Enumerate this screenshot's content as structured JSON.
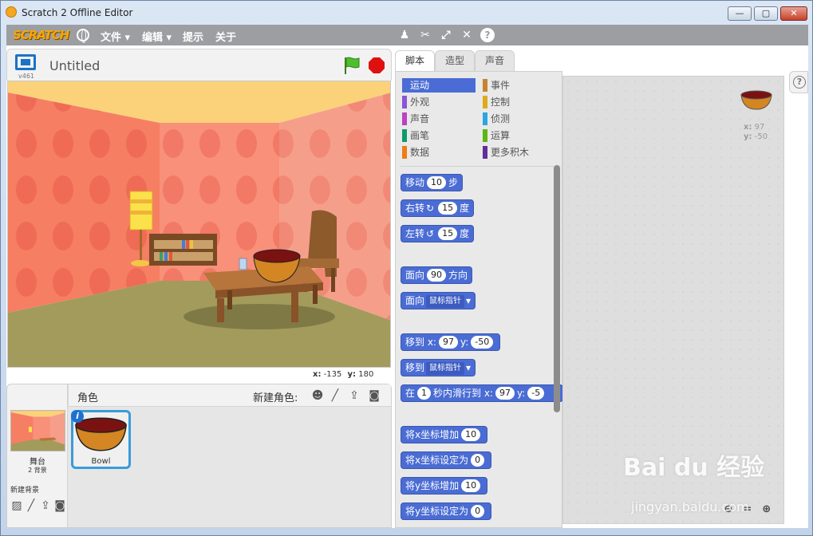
{
  "window": {
    "title": "Scratch 2 Offline Editor",
    "min": "—",
    "max": "▢",
    "close": "✕"
  },
  "menubar": {
    "logo": "SCRATCH",
    "items": [
      "文件 ▾",
      "编辑 ▾",
      "提示",
      "关于"
    ],
    "tools": [
      "stamp-icon",
      "cut-icon",
      "grow-icon",
      "shrink-icon",
      "help-icon"
    ]
  },
  "stage": {
    "version": "v461",
    "project_title": "Untitled",
    "coords": {
      "x_label": "x:",
      "x": "-135",
      "y_label": "y:",
      "y": "180"
    }
  },
  "sprites": {
    "label": "角色",
    "new_sprite_label": "新建角色:",
    "stage_name": "舞台",
    "stage_bg_count": "2 背景",
    "new_backdrop_label": "新建背景",
    "sprite_name": "Bowl"
  },
  "tabs": [
    "脚本",
    "造型",
    "声音"
  ],
  "categories": {
    "left": [
      {
        "label": "运动",
        "color": "#4a6cd4"
      },
      {
        "label": "外观",
        "color": "#8a55d7"
      },
      {
        "label": "声音",
        "color": "#bb42c3"
      },
      {
        "label": "画笔",
        "color": "#0e9a6c"
      },
      {
        "label": "数据",
        "color": "#ee7d16"
      }
    ],
    "right": [
      {
        "label": "事件",
        "color": "#c88330"
      },
      {
        "label": "控制",
        "color": "#e1a91a"
      },
      {
        "label": "侦测",
        "color": "#2ca5e2"
      },
      {
        "label": "运算",
        "color": "#5cb712"
      },
      {
        "label": "更多积木",
        "color": "#632d99"
      }
    ]
  },
  "blocks": {
    "move": {
      "a": "移动",
      "n": "10",
      "b": "步"
    },
    "turn_right": {
      "a": "右转",
      "n": "15",
      "b": "度"
    },
    "turn_left": {
      "a": "左转",
      "n": "15",
      "b": "度"
    },
    "point_dir": {
      "a": "面向",
      "n": "90",
      "b": "方向"
    },
    "point_towards": {
      "a": "面向",
      "dd": "鼠标指针"
    },
    "goto_xy": {
      "a": "移到 x:",
      "x": "97",
      "b": "y:",
      "y": "-50"
    },
    "goto": {
      "a": "移到",
      "dd": "鼠标指针"
    },
    "glide": {
      "a": "在",
      "n": "1",
      "b": "秒内滑行到 x:",
      "x": "97",
      "c": "y:",
      "y": "-5"
    },
    "change_x": {
      "a": "将x坐标增加",
      "n": "10"
    },
    "set_x": {
      "a": "将x坐标设定为",
      "n": "0"
    },
    "change_y": {
      "a": "将y坐标增加",
      "n": "10"
    },
    "set_y": {
      "a": "将y坐标设定为",
      "n": "0"
    }
  },
  "script_area": {
    "x_label": "x:",
    "x": "97",
    "y_label": "y:",
    "y": "-50"
  },
  "watermark": {
    "brand": "Bai du 经验",
    "url": "jingyan.baidu.com"
  }
}
